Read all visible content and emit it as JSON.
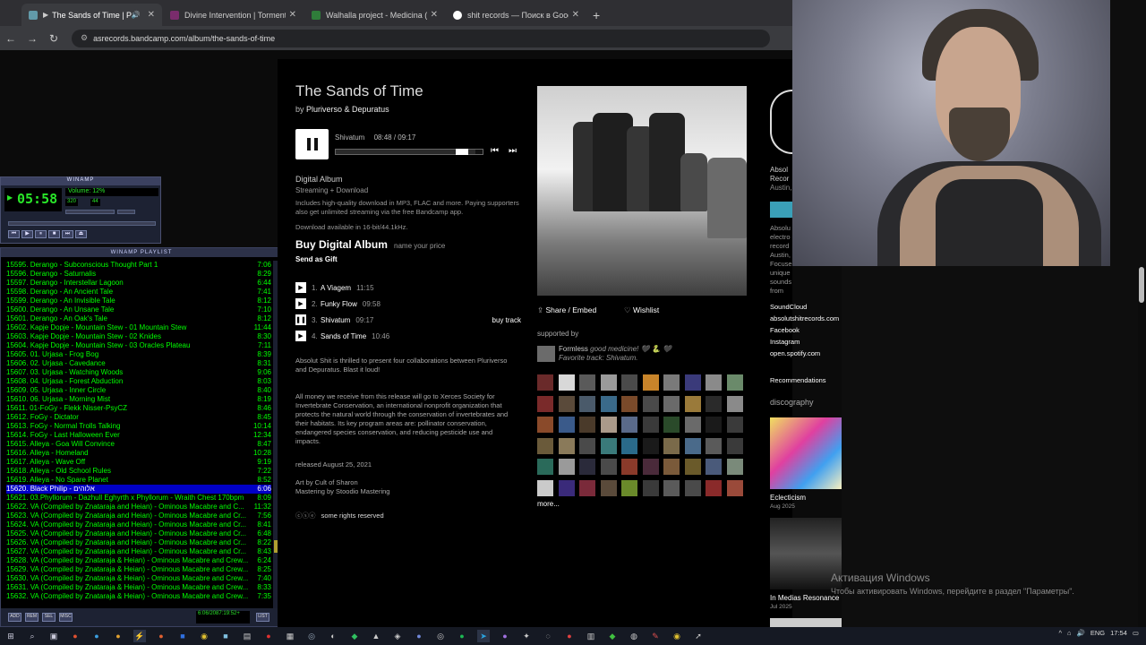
{
  "browser": {
    "tabs": [
      {
        "title": "The Sands of Time | Plur",
        "favicon_color": "#629aa9",
        "active": true
      },
      {
        "title": "Divine Intervention | TormentO",
        "favicon_color": "#7a2c6c",
        "active": false
      },
      {
        "title": "Walhalla project - Medicina (Fl",
        "favicon_color": "#2f7d3a",
        "active": false
      },
      {
        "title": "shit records — Поиск в Google",
        "favicon_color": "#ffffff",
        "active": false
      }
    ],
    "url": "asrecords.bandcamp.com/album/the-sands-of-time"
  },
  "winamp": {
    "title": "WINAMP",
    "time": "05:58",
    "info": "Volume: 12%",
    "kbps": "320",
    "khz": "44"
  },
  "playlist": {
    "title": "WINAMP PLAYLIST",
    "items": [
      {
        "t": "15595. Derango - Subconscious Thought Part 1",
        "d": "7:06"
      },
      {
        "t": "15596. Derango - Saturnalis",
        "d": "8:29"
      },
      {
        "t": "15597. Derango - Interstellar Lagoon",
        "d": "6:44"
      },
      {
        "t": "15598. Derango - An Ancient Tale",
        "d": "7:41"
      },
      {
        "t": "15599. Derango - An Invisible Tale",
        "d": "8:12"
      },
      {
        "t": "15600. Derango - An Unsane Tale",
        "d": "7:10"
      },
      {
        "t": "15601. Derango - An Oak's Tale",
        "d": "8:12"
      },
      {
        "t": "15602. Kapje Dopje - Mountain Stew - 01 Mountain Stew",
        "d": "11:44"
      },
      {
        "t": "15603. Kapje Dopje - Mountain Stew - 02 Knides",
        "d": "8:30"
      },
      {
        "t": "15604. Kapje Dopje - Mountain Stew - 03 Oracles Plateau",
        "d": "7:11"
      },
      {
        "t": "15605. 01. Urjasa - Frog Bog",
        "d": "8:39"
      },
      {
        "t": "15606. 02. Urjasa - Cavedance",
        "d": "8:31"
      },
      {
        "t": "15607. 03. Urjasa - Watching Woods",
        "d": "9:06"
      },
      {
        "t": "15608. 04. Urjasa - Forest Abduction",
        "d": "8:03"
      },
      {
        "t": "15609. 05. Urjasa - Inner Circle",
        "d": "8:40"
      },
      {
        "t": "15610. 06. Urjasa - Morning Mist",
        "d": "8:19"
      },
      {
        "t": "15611. 01-FoGy - Flekk Nisser-PsyCZ",
        "d": "8:46"
      },
      {
        "t": "15612. FoGy - Dictator",
        "d": "8:45"
      },
      {
        "t": "15613. FoGy - Normal Trolls Talking",
        "d": "10:14"
      },
      {
        "t": "15614. FoGy - Last Halloween Ever",
        "d": "12:34"
      },
      {
        "t": "15615. Alleya - Goa Will Convince",
        "d": "8:47"
      },
      {
        "t": "15616. Alleya - Homeland",
        "d": "10:28"
      },
      {
        "t": "15617. Alleya - Wave Off",
        "d": "9:19"
      },
      {
        "t": "15618. Alleya - Old School Rules",
        "d": "7:22"
      },
      {
        "t": "15619. Alleya - No Spare Planet",
        "d": "8:52"
      },
      {
        "t": "15620. Black Philip - אלוהים",
        "d": "6:06",
        "sel": true
      },
      {
        "t": "15621. 03.Phyllorum - Dazhull Eghyrth x Phyllorum - Wraith Chest 170bpm",
        "d": "8:09"
      },
      {
        "t": "15622. VA (Compiled by Znataraja and Heian) - Ominous Macabre and C...",
        "d": "11:32"
      },
      {
        "t": "15623. VA (Compiled by Znataraja and Heian) - Ominous Macabre and Cr...",
        "d": "7:56"
      },
      {
        "t": "15624. VA (Compiled by Znataraja and Heian) - Ominous Macabre and Cr...",
        "d": "8:41"
      },
      {
        "t": "15625. VA (Compiled by Znataraja and Heian) - Ominous Macabre and Cr...",
        "d": "6:48"
      },
      {
        "t": "15626. VA (Compiled by Znataraja and Heian) - Ominous Macabre and Cr...",
        "d": "8:22"
      },
      {
        "t": "15627. VA (Compiled by Znataraja and Heian) - Ominous Macabre and Cr...",
        "d": "8:43"
      },
      {
        "t": "15628. VA (Compiled by Znataraja & Heian) - Ominous Macabre and Crew...",
        "d": "6:24"
      },
      {
        "t": "15629. VA (Compiled by Znataraja & Heian) - Ominous Macabre and Crew...",
        "d": "8:25"
      },
      {
        "t": "15630. VA (Compiled by Znataraja & Heian) - Ominous Macabre and Crew...",
        "d": "7:40"
      },
      {
        "t": "15631. VA (Compiled by Znataraja & Heian) - Ominous Macabre and Crew...",
        "d": "8:33"
      },
      {
        "t": "15632. VA (Compiled by Znataraja & Heian) - Ominous Macabre and Crew...",
        "d": "7:35"
      }
    ],
    "bottom_time": "6:06/2087:19:52+"
  },
  "album": {
    "title": "The Sands of Time",
    "by_prefix": "by",
    "artist": "Pluriverso & Depuratus",
    "now_playing": "Shivatum",
    "elapsed": "08:48 / 09:17",
    "progress": 0.95,
    "format_title": "Digital Album",
    "format_sub": "Streaming + Download",
    "format_desc": "Includes high-quality download in MP3, FLAC and more. Paying supporters also get unlimited streaming via the free Bandcamp app.",
    "format_avail": "Download available in 16-bit/44.1kHz.",
    "buy_label": "Buy Digital Album",
    "buy_price": "name your price",
    "gift_label": "Send as Gift",
    "tracks": [
      {
        "num": "1.",
        "name": "A Viagem",
        "dur": "11:15",
        "playing": false
      },
      {
        "num": "2.",
        "name": "Funky Flow",
        "dur": "09:58",
        "playing": false
      },
      {
        "num": "3.",
        "name": "Shivatum",
        "dur": "09:17",
        "playing": true,
        "buy": "buy track"
      },
      {
        "num": "4.",
        "name": "Sands of Time",
        "dur": "10:46",
        "playing": false
      }
    ],
    "about": "Absolut Shit is thrilled to present four collaborations between Pluriverso and Depuratus. Blast it loud!",
    "money": "All money we receive from this release will go to Xerces Society for Invertebrate Conservation, an international nonprofit organization that protects the natural world through the conservation of invertebrates and their habitats. Its key program areas are: pollinator conservation, endangered species conservation, and reducing pesticide use and impacts.",
    "released": "released August 25, 2021",
    "credit1": "Art by Cult of Sharon",
    "credit2": "Mastering by Stoodio Mastering",
    "rights": "some rights reserved",
    "share": "Share / Embed",
    "wishlist": "Wishlist",
    "supported_by": "supported by",
    "supporter_name": "Formless",
    "supporter_quote": "good medicine! 🖤 🐍 🖤",
    "fav_track": "Favorite track: Shivatum.",
    "more": "more..."
  },
  "label": {
    "name_part": "Absol\nRecor",
    "location": "Austin,",
    "desc": "Absolu electro record Austin, Focuse unique sounds from artists around the world!",
    "desc_visible": "Absolu\nelectro\nrecord\nAustin,\nFocuse",
    "links": [
      "SoundCloud",
      "absolutshitrecords.com",
      "Facebook",
      "Instagram",
      "open.spotify.com"
    ],
    "recommendations": "Recommendations",
    "discography_title": "discography",
    "disco": [
      {
        "name": "Eclecticism",
        "date": "Aug 2025"
      },
      {
        "name": "In Medias Resonance",
        "date": "Jul 2025"
      }
    ]
  },
  "windows": {
    "activate_title": "Активация Windows",
    "activate_sub": "Чтобы активировать Windows, перейдите в раздел \"Параметры\".",
    "lang": "ENG",
    "time": "17:54"
  }
}
